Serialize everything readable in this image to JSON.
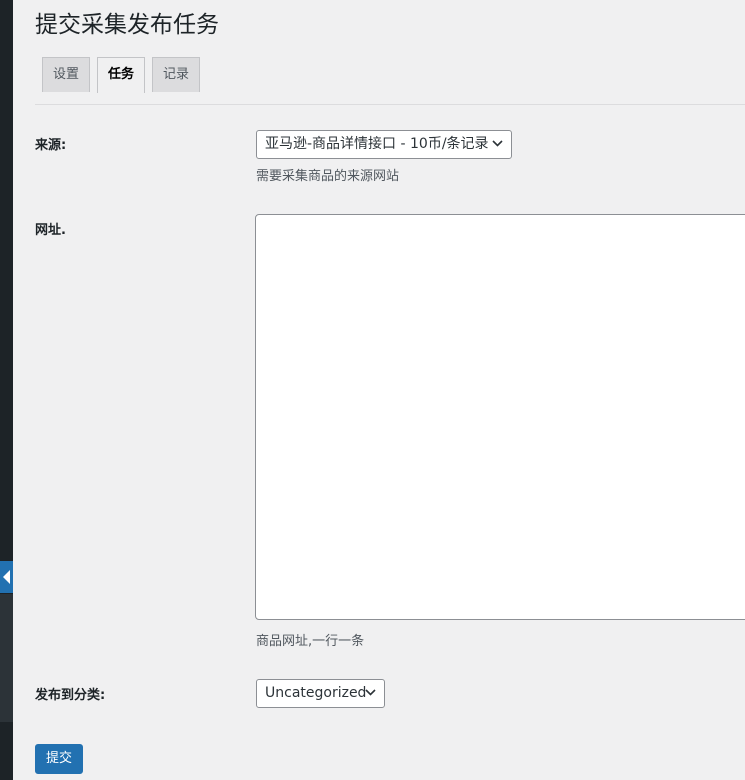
{
  "page": {
    "title": "提交采集发布任务"
  },
  "tabs": [
    {
      "label": "设置",
      "active": false
    },
    {
      "label": "任务",
      "active": true
    },
    {
      "label": "记录",
      "active": false
    }
  ],
  "form": {
    "source": {
      "label": "来源:",
      "selected": "亚马逊-商品详情接口 - 10币/条记录",
      "description": "需要采集商品的来源网站"
    },
    "urls": {
      "label": "网址.",
      "value": "",
      "description": "商品网址,一行一条"
    },
    "category": {
      "label": "发布到分类:",
      "selected": "Uncategorized"
    },
    "submit_label": "提交"
  },
  "icons": {
    "collapse": "collapse-arrow-left-icon",
    "chevron": "chevron-down-icon"
  },
  "colors": {
    "background": "#f0f0f1",
    "primary_button": "#2271b1",
    "admin_sidebar": "#1d2327"
  }
}
